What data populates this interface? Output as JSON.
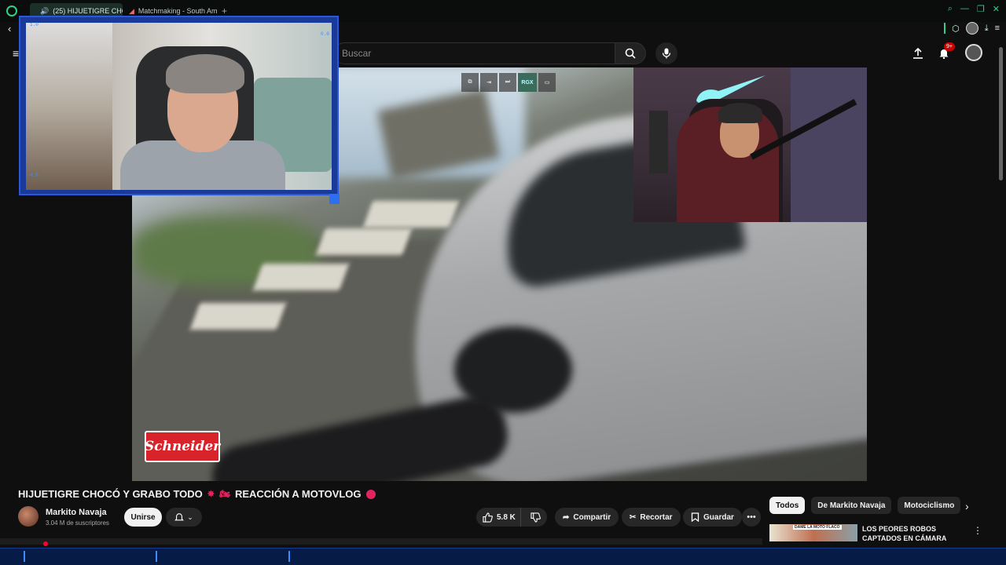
{
  "browser": {
    "tabs": [
      {
        "label": "(25) HIJUETIGRE CHO",
        "active": true
      },
      {
        "label": "Matchmaking - South Am",
        "active": false
      }
    ]
  },
  "header": {
    "search_placeholder": "Buscar",
    "notification_count": "9+"
  },
  "player": {
    "controls": [
      "pip",
      "enter",
      "next",
      "RGX",
      "theater"
    ],
    "rgx_label": "RGX",
    "sponsor_logo": "Schneider"
  },
  "webcam_left": {
    "hud_top_left": "1.0",
    "hud_top_right": "0.0",
    "hud_bottom_left": "4.8"
  },
  "video": {
    "title": "HIJUETIGRE CHOCÓ Y GRABO TODO",
    "title_suffix": "REACCIÓN A MOTOVLOG",
    "channel_name": "Markito Navaja",
    "subscribers": "3.04 M de suscriptores",
    "join_label": "Unirse",
    "like_count": "5.8 K",
    "share_label": "Compartir",
    "clip_label": "Recortar",
    "save_label": "Guardar"
  },
  "sidebar": {
    "chips": [
      "Todos",
      "De Markito Navaja",
      "Motociclismo"
    ],
    "recommendation": {
      "title": "LOS PEORES ROBOS CAPTADOS EN CÁMARA",
      "thumb_text": "DAME LA MOTO FLACO"
    }
  },
  "colors": {
    "accent_green": "#2fd18b",
    "youtube_red": "#ff0000",
    "webcam_frame": "#2c57d6"
  }
}
